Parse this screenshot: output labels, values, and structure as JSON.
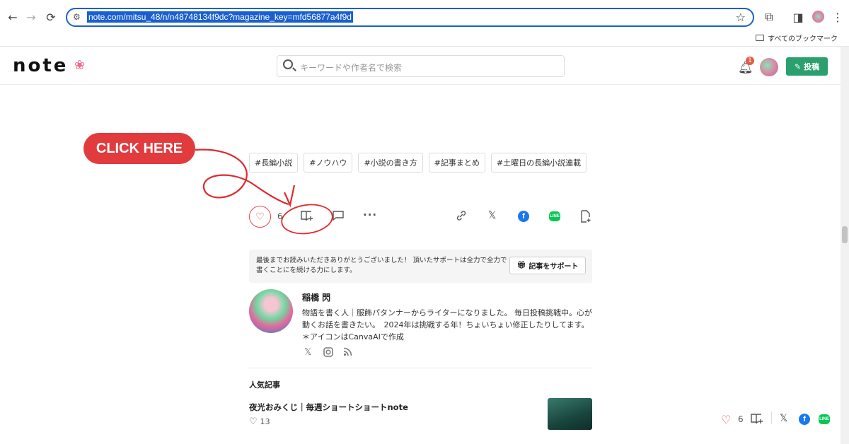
{
  "browser": {
    "url": "note.com/mitsu_48/n/n48748134f9dc?magazine_key=mfd56877a4f9d",
    "bookmarks_label": "すべてのブックマーク"
  },
  "header": {
    "logo": "note",
    "search_placeholder": "キーワードや作者名で検索",
    "notification_count": "1",
    "post_label": "投稿"
  },
  "annotation": {
    "callout": "CLICK HERE"
  },
  "tags": [
    "#長編小説",
    "#ノウハウ",
    "#小説の書き方",
    "#記事まとめ",
    "#土曜日の長編小説連載"
  ],
  "actions": {
    "like_count": "6"
  },
  "support": {
    "message": "最後までお読みいただきありがとうございました！ 頂いたサポートは全力で全力で書くことにを続ける力にします。",
    "button_label": "記事をサポート"
  },
  "author": {
    "name": "稲橋 閃",
    "bio": "物語を書く人｜服飾パタンナーからライターになりました。 毎日投稿挑戦中。心が動くお話を書きたい。　2024年は挑戦する年！ちょいちょい修正したりしてます。 ＊アイコンはCanvaAIで作成"
  },
  "popular": {
    "heading": "人気記事",
    "items": [
      {
        "title": "夜光おみくじ｜毎週ショートショートnote",
        "likes": "13"
      }
    ]
  },
  "floating_bar": {
    "like_count": "6"
  }
}
